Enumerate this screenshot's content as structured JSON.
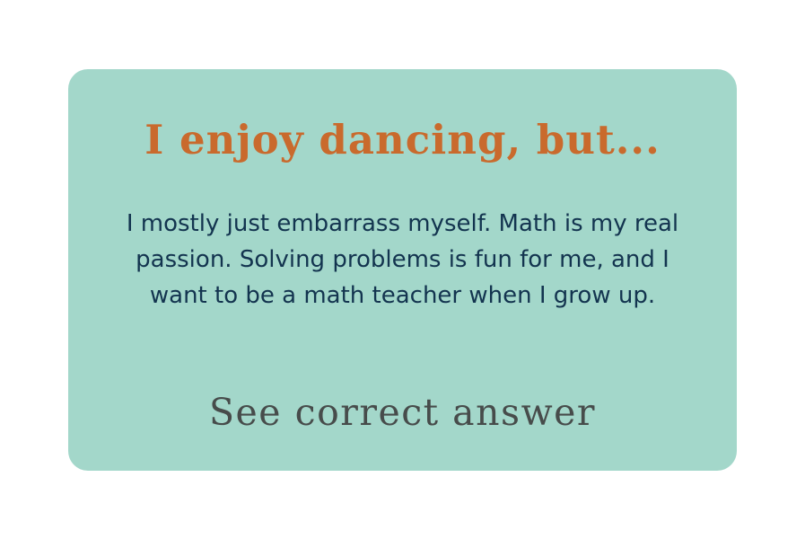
{
  "card": {
    "title": "I enjoy dancing, but...",
    "body": "I mostly just embarrass myself. Math is my real passion. Solving problems is fun for me, and I want to be a math teacher when I grow up.",
    "answer_button_label": "See correct answer"
  },
  "colors": {
    "card_background": "#a3d7ca",
    "title": "#c96a2d",
    "body_text": "#13344f",
    "link_text": "#474c4b"
  }
}
